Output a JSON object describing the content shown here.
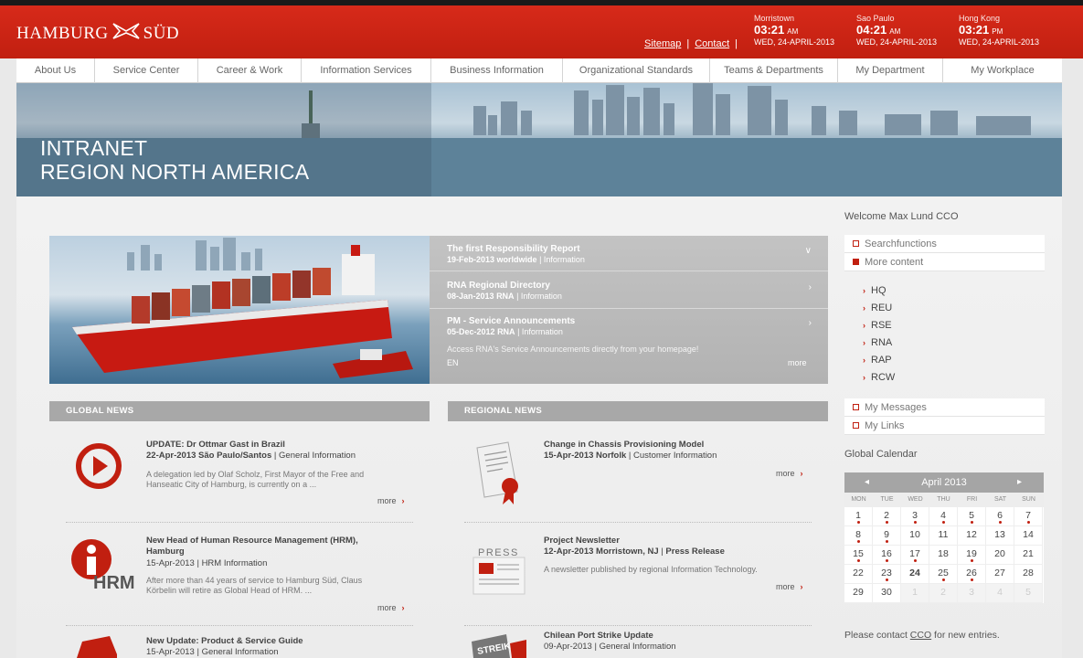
{
  "header": {
    "logo_left": "HAMBURG",
    "logo_right": "SÜD",
    "links": [
      {
        "label": "Sitemap"
      },
      {
        "label": "Contact"
      }
    ],
    "clocks": [
      {
        "city": "Morristown",
        "time": "03:21",
        "ampm": "AM",
        "date": "WED, 24-APRIL-2013"
      },
      {
        "city": "Sao Paulo",
        "time": "04:21",
        "ampm": "AM",
        "date": "WED, 24-APRIL-2013"
      },
      {
        "city": "Hong Kong",
        "time": "03:21",
        "ampm": "PM",
        "date": "WED, 24-APRIL-2013"
      }
    ]
  },
  "nav": [
    "About Us",
    "Service Center",
    "Career & Work",
    "Information Services",
    "Business Information",
    "Organizational Standards",
    "Teams & Departments",
    "My Department",
    "My Workplace"
  ],
  "banner": {
    "line1": "INTRANET",
    "line2": "REGION NORTH AMERICA"
  },
  "teasers": [
    {
      "title": "The first Responsibility Report",
      "date": "19-Feb-2013",
      "scope": "worldwide",
      "category": "Information"
    },
    {
      "title": "RNA Regional Directory",
      "date": "08-Jan-2013",
      "scope": "RNA",
      "category": "Information"
    },
    {
      "title": "PM - Service Announcements",
      "date": "05-Dec-2012",
      "scope": "RNA",
      "category": "Information"
    }
  ],
  "teaser_desc": "Access RNA's Service Announcements directly from your homepage!",
  "teaser_lang": "EN",
  "teaser_more": "more",
  "global_news": {
    "heading": "GLOBAL NEWS",
    "items": [
      {
        "title": "UPDATE: Dr Ottmar Gast in Brazil",
        "date": "22-Apr-2013",
        "place": "São Paulo/Santos",
        "category": "General Information",
        "desc1": "A delegation led by Olaf Scholz, First Mayor of the Free and",
        "desc2": "Hanseatic City of Hamburg, is currently on a ...",
        "more": "more"
      },
      {
        "title": "New Head of Human Resource Management (HRM),",
        "title2": "Hamburg",
        "date": "15-Apr-2013",
        "category": "HRM Information",
        "desc1": "After more than 44 years of service to Hamburg Süd, Claus",
        "desc2": "Körbelin will retire as Global Head of HRM. ...",
        "more": "more"
      },
      {
        "title": "New Update: Product & Service Guide",
        "date": "15-Apr-2013",
        "category": "General Information"
      }
    ]
  },
  "regional_news": {
    "heading": "REGIONAL NEWS",
    "items": [
      {
        "title": "Change in Chassis Provisioning Model",
        "date": "15-Apr-2013",
        "place": "Norfolk",
        "category": "Customer Information",
        "more": "more"
      },
      {
        "title": "Project Newsletter",
        "date": "12-Apr-2013",
        "place": "Morristown, NJ",
        "category": "Press Release",
        "desc1": "A newsletter published by regional Information Technology.",
        "more": "more",
        "icon_text": "PRESS"
      },
      {
        "title": "Chilean Port Strike Update",
        "date": "09-Apr-2013",
        "category": "General Information",
        "icon_text": "STREIK"
      }
    ]
  },
  "hrm_icon_text": "HRM",
  "sidebar": {
    "welcome": "Welcome Max Lund CCO",
    "rows_top": [
      "Searchfunctions",
      "More content"
    ],
    "sub_items": [
      "HQ",
      "REU",
      "RSE",
      "RNA",
      "RAP",
      "RCW"
    ],
    "rows_bottom": [
      "My Messages",
      "My Links"
    ]
  },
  "calendar": {
    "title": "Global Calendar",
    "month": "April 2013",
    "prev": "◂",
    "next": "▸",
    "dow": [
      "MON",
      "TUE",
      "WED",
      "THU",
      "FRI",
      "SAT",
      "SUN"
    ],
    "days": [
      {
        "d": "1",
        "ev": true
      },
      {
        "d": "2",
        "ev": true
      },
      {
        "d": "3",
        "ev": true
      },
      {
        "d": "4",
        "ev": true
      },
      {
        "d": "5",
        "ev": true
      },
      {
        "d": "6",
        "ev": true
      },
      {
        "d": "7",
        "ev": true
      },
      {
        "d": "8",
        "ev": true
      },
      {
        "d": "9",
        "ev": true
      },
      {
        "d": "10"
      },
      {
        "d": "11"
      },
      {
        "d": "12"
      },
      {
        "d": "13"
      },
      {
        "d": "14"
      },
      {
        "d": "15",
        "ev": true
      },
      {
        "d": "16",
        "ev": true
      },
      {
        "d": "17",
        "ev": true
      },
      {
        "d": "18"
      },
      {
        "d": "19",
        "ev": true
      },
      {
        "d": "20"
      },
      {
        "d": "21"
      },
      {
        "d": "22"
      },
      {
        "d": "23",
        "ev": true
      },
      {
        "d": "24",
        "bold": true
      },
      {
        "d": "25",
        "ev": true
      },
      {
        "d": "26",
        "ev": true
      },
      {
        "d": "27"
      },
      {
        "d": "28"
      },
      {
        "d": "29"
      },
      {
        "d": "30"
      },
      {
        "d": "1",
        "other": true
      },
      {
        "d": "2",
        "other": true
      },
      {
        "d": "3",
        "other": true
      },
      {
        "d": "4",
        "other": true
      },
      {
        "d": "5",
        "other": true
      }
    ],
    "note_pre": "Please contact ",
    "note_link": "CCO",
    "note_post": " for new entries."
  },
  "colors": {
    "brand_red": "#c11f10",
    "header_red": "#d72a1a",
    "panel_grey": "#a8a8a8"
  }
}
